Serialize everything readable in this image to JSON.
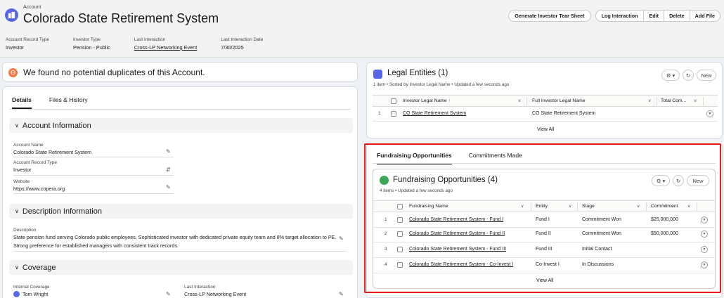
{
  "header": {
    "object_label": "Account",
    "title": "Colorado State Retirement System",
    "actions": [
      "Generate Investor Tear Sheet",
      "Log Interaction",
      "Edit",
      "Delete",
      "Add File"
    ],
    "fields": [
      {
        "label": "Account Record Type",
        "value": "Investor"
      },
      {
        "label": "Investor Type",
        "value": "Pension - Public"
      },
      {
        "label": "Last Interaction",
        "value": "Cross-LP Networking Event"
      },
      {
        "label": "Last Interaction Date",
        "value": "7/30/2025"
      }
    ]
  },
  "duplicates": {
    "text": "We found no potential duplicates of this Account.",
    "icon": "duplicate-alert-icon"
  },
  "left": {
    "tabs": [
      "Details",
      "Files & History"
    ],
    "account_info": {
      "title": "Account Information",
      "fields": [
        {
          "label": "Account Name",
          "value": "Colorado State Retirement System"
        },
        {
          "label": "Account Record Type",
          "value": "Investor"
        },
        {
          "label": "Website",
          "value": "https://www.copera.org"
        }
      ]
    },
    "description_info": {
      "title": "Description Information",
      "label": "Description",
      "line1": "State pension fund serving Colorado public employees. Sophisticated investor with dedicated private equity team and 8% target allocation to PE.",
      "line2": "Strong preference for established managers with consistent track records."
    },
    "coverage": {
      "title": "Coverage",
      "internal_label": "Internal Coverage",
      "internal_value": "Tom Wright",
      "last_label": "Last Interaction",
      "last_value": "Cross-LP Networking Event"
    }
  },
  "legal_entities": {
    "title": "Legal Entities (1)",
    "subtitle": "1 item • Sorted by Investor Legal Name • Updated a few seconds ago",
    "new_label": "New",
    "columns": [
      "Investor Legal Name",
      "Full Investor Legal Name",
      "Total Com..."
    ],
    "rows": [
      {
        "num": "1",
        "name": "CO State Retirement System",
        "full": "CO State Retirement System",
        "total": ""
      }
    ],
    "view_all": "View All"
  },
  "fundraising": {
    "tabs": [
      "Fundraising Opportunities",
      "Commitments Made"
    ],
    "title": "Fundraising Opportunities (4)",
    "subtitle": "4 items • Updated a few seconds ago",
    "new_label": "New",
    "columns": [
      "Fundraising Name",
      "Entity",
      "Stage",
      "Commitment"
    ],
    "rows": [
      {
        "num": "1",
        "name": "Colorado State Retirement System - Fund I",
        "entity": "Fund I",
        "stage": "Commitment Won",
        "commitment": "$25,000,000"
      },
      {
        "num": "2",
        "name": "Colorado State Retirement System - Fund II",
        "entity": "Fund II",
        "stage": "Commitment Won",
        "commitment": "$50,000,000"
      },
      {
        "num": "3",
        "name": "Colorado State Retirement System - Fund III",
        "entity": "Fund III",
        "stage": "Initial Contact",
        "commitment": ""
      },
      {
        "num": "4",
        "name": "Colorado State Retirement System - Co-Invest I",
        "entity": "Co-Invest I",
        "stage": "In Discussions",
        "commitment": ""
      }
    ],
    "view_all": "View All"
  },
  "colors": {
    "brand_icon": "#5867e8",
    "opportunity_icon": "#3ba755",
    "highlight": "#e41c1c",
    "alert": "#f07b47"
  }
}
